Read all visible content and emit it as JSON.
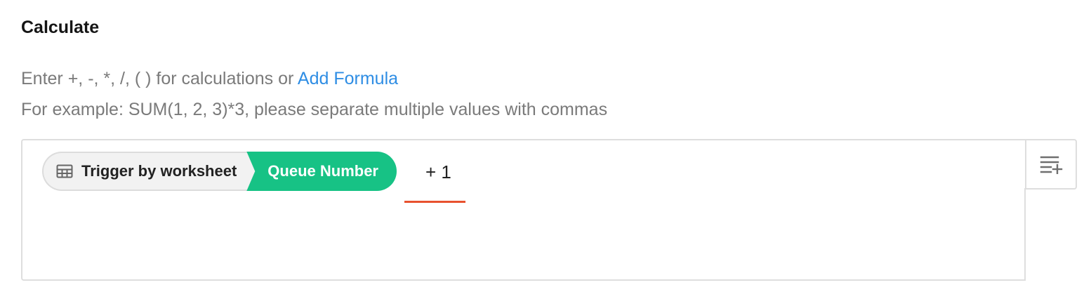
{
  "section": {
    "title": "Calculate"
  },
  "hint": {
    "line1_prefix": "Enter +, -, *, /, ( ) for calculations or",
    "add_formula_link": "Add Formula",
    "line2": "For example: SUM(1, 2, 3)*3, please separate multiple values with commas"
  },
  "editor": {
    "tag": {
      "source_icon": "table-grid-icon",
      "source_label": "Trigger by worksheet",
      "field_label": "Queue Number",
      "field_color": "#17c285"
    },
    "expression": "+ 1",
    "error_underline_color": "#e8522f",
    "insert_button_icon": "insert-list-icon"
  }
}
